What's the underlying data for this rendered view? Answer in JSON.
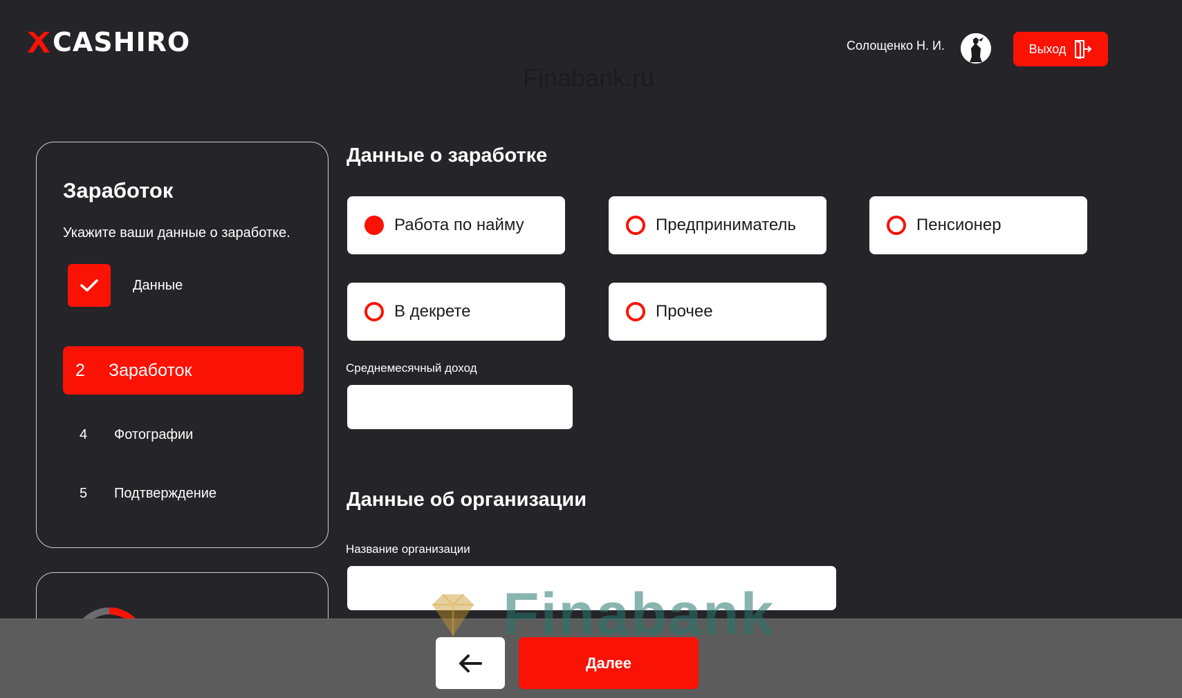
{
  "header": {
    "logo_text": "CASHIRO",
    "watermark": "Finabank.ru",
    "user_name": "Солощенко Н. И.",
    "logout_label": "Выход",
    "logout_icon": "logout-door-icon"
  },
  "sidebar": {
    "title": "Заработок",
    "description": "Укажите ваши данные о заработке.",
    "completed_step": {
      "label": "Данные",
      "icon": "checkmark-icon"
    },
    "active_step": {
      "number": "2",
      "label": "Заработок"
    },
    "steps": [
      {
        "number": "4",
        "label": "Фотографии"
      },
      {
        "number": "5",
        "label": "Подтверждение"
      }
    ]
  },
  "income_section": {
    "title": "Данные о заработке",
    "options": [
      {
        "label": "Работа по найму",
        "checked": true
      },
      {
        "label": "Предприниматель",
        "checked": false
      },
      {
        "label": "Пенсионер",
        "checked": false
      },
      {
        "label": "В декрете",
        "checked": false
      },
      {
        "label": "Прочее",
        "checked": false
      }
    ],
    "income_label": "Среднемесячный доход",
    "income_value": ""
  },
  "org_section": {
    "title": "Данные об организации",
    "name_label": "Название организации",
    "name_value": ""
  },
  "footer": {
    "back_icon": "arrow-left-icon",
    "next_label": "Далее",
    "watermark": "Finabank"
  },
  "colors": {
    "accent": "#fa1205",
    "background": "#252429",
    "footer_bar": "#5c5c5c"
  }
}
